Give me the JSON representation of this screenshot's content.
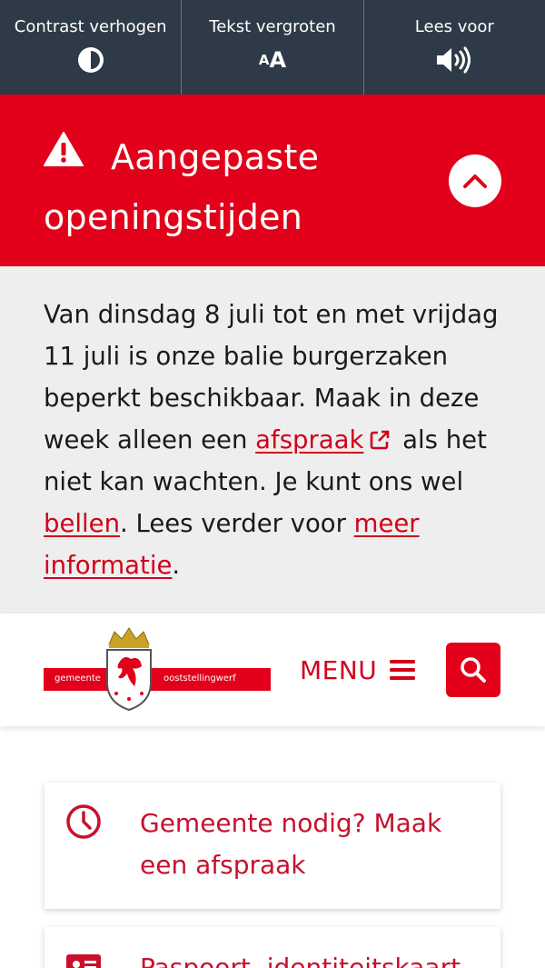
{
  "accessibility_bar": {
    "contrast_label": "Contrast verhogen",
    "text_size_label": "Tekst vergroten",
    "text_size_icon_small": "A",
    "text_size_icon_big": "A",
    "read_aloud_label": "Lees voor"
  },
  "alert": {
    "title": "Aangepaste openingstijden",
    "text_part1": "Van dinsdag 8 juli tot en met vrijdag 11 juli is onze balie burgerzaken beperkt beschikbaar. Maak in deze week alleen een ",
    "link_appointment": "afspraak",
    "text_part2": " als het niet kan wachten. Je kunt ons wel ",
    "link_call": "bellen",
    "text_part3": ". Lees verder voor ",
    "link_more_info": "meer informatie",
    "text_part4": ".",
    "colors": {
      "banner": "#e2001a",
      "body_bg": "#eeeeee",
      "link": "#d0021b"
    }
  },
  "header": {
    "logo_left": "gemeente",
    "logo_right": "ooststellingwerf",
    "menu_label": "MENU"
  },
  "cards": [
    {
      "label": "Gemeente nodig? Maak een afspraak",
      "icon": "clock-icon"
    },
    {
      "label": "Paspoort, identiteitskaart",
      "icon": "id-card-icon"
    }
  ],
  "colors": {
    "top_bar": "#2e3a47",
    "brand_red": "#e2001a"
  }
}
